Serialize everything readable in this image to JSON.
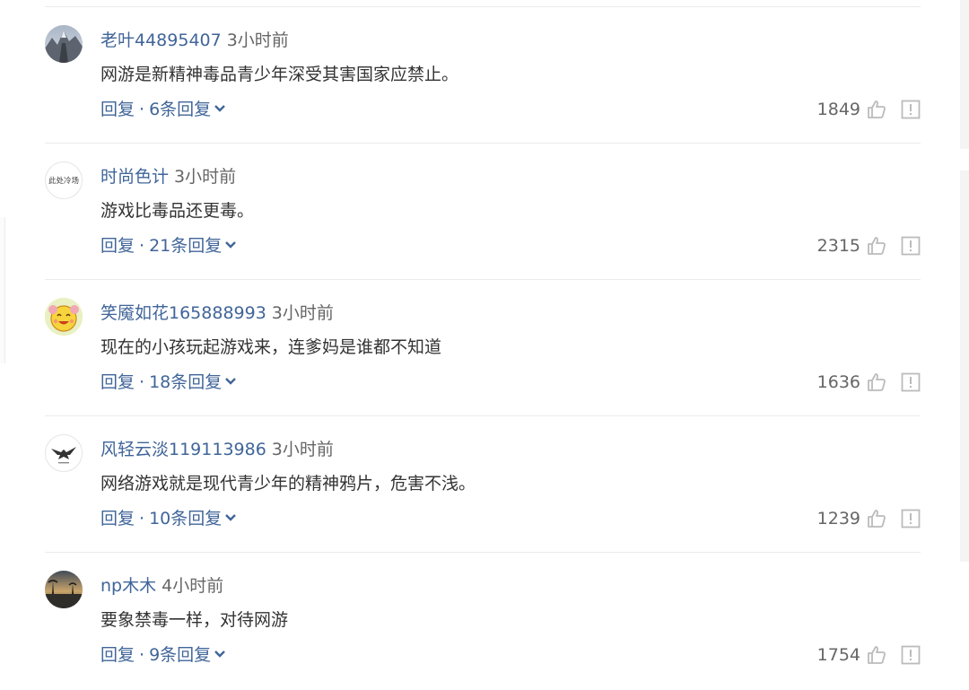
{
  "comments": [
    {
      "username": "老叶44895407",
      "time": "3小时前",
      "text": "网游是新精神毒品青少年深受其害国家应禁止。",
      "reply_label": "回复",
      "separator": "·",
      "replies_label": "6条回复",
      "likes": "1849",
      "avatar": "mountain-photo"
    },
    {
      "username": "时尚色计",
      "time": "3小时前",
      "text": "游戏比毒品还更毒。",
      "reply_label": "回复",
      "separator": "·",
      "replies_label": "21条回复",
      "likes": "2315",
      "avatar": "text-logo",
      "avatar_text": "此处冷场"
    },
    {
      "username": "笑魇如花165888993",
      "time": "3小时前",
      "text": "现在的小孩玩起游戏来，连爹妈是谁都不知道",
      "reply_label": "回复",
      "separator": "·",
      "replies_label": "18条回复",
      "likes": "1636",
      "avatar": "cartoon-face"
    },
    {
      "username": "风轻云淡119113986",
      "time": "3小时前",
      "text": "网络游戏就是现代青少年的精神鸦片，危害不浅。",
      "reply_label": "回复",
      "separator": "·",
      "replies_label": "10条回复",
      "likes": "1239",
      "avatar": "eagle-emblem"
    },
    {
      "username": "np木木",
      "time": "4小时前",
      "text": "要象禁毒一样，对待网游",
      "reply_label": "回复",
      "separator": "·",
      "replies_label": "9条回复",
      "likes": "1754",
      "avatar": "sunset-photo"
    }
  ],
  "icons": {
    "like": "thumbs-up-icon",
    "report": "report-icon",
    "expand": "chevron-down-icon"
  },
  "colors": {
    "link": "#406599",
    "text": "#333333",
    "muted": "#666666",
    "icon": "#bbbbbb",
    "divider": "#ebebeb"
  }
}
